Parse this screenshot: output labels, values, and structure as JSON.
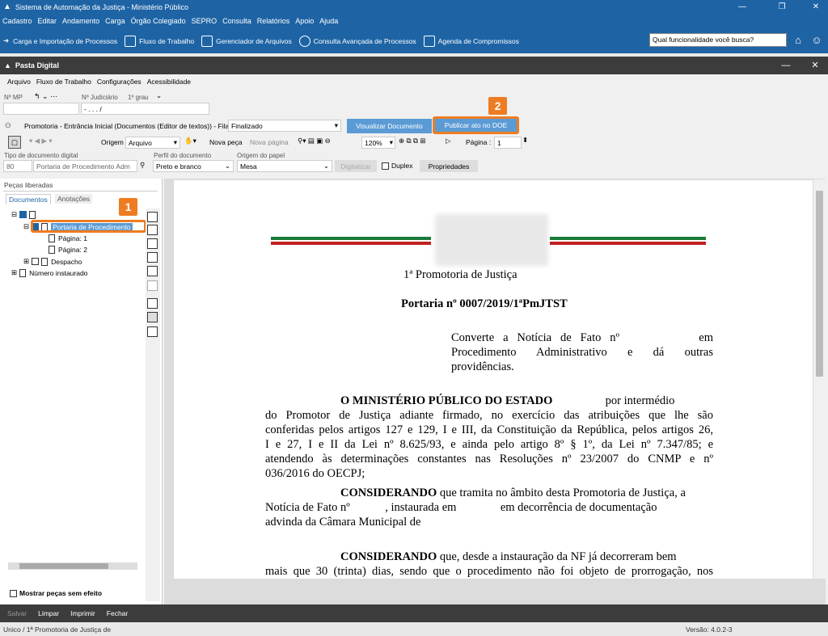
{
  "window": {
    "title": "Sistema de Automação da Justiça - Ministério Público",
    "min": "—",
    "restore": "❐",
    "close": "✕"
  },
  "menu": [
    "Cadastro",
    "Editar",
    "Andamento",
    "Carga",
    "Órgão Colegiado",
    "SEPRO",
    "Consulta",
    "Relatórios",
    "Apoio",
    "Ajuda"
  ],
  "quick": {
    "items": [
      "Carga e Importação de Processos",
      "Fluxo de Trabalho",
      "Gerenciador de Arquivos",
      "Consulta Avançada de Processos",
      "Agenda de Compromissos"
    ],
    "search_placeholder": "Qual funcionalidade você busca?"
  },
  "pasta": {
    "title": "Pasta Digital",
    "min": "—",
    "close": "✕"
  },
  "menu2": [
    "Arquivo",
    "Fluxo de Trabalho",
    "Configurações",
    "Acessibilidade"
  ],
  "fields": {
    "nmp_label": "Nº MP",
    "nj_label": "Nº Judiciário",
    "grau": "1º grau",
    "nj_value": "- . . . /",
    "fila_text": "Promotoria - Entrância Inicial (Documentos (Editor de textos)) - Fila",
    "fila_value": "Finalizado"
  },
  "buttons": {
    "visualizar": "Visualizar Documento",
    "publicar": "Publicar ato no DOE",
    "badge1": "1",
    "badge2": "2"
  },
  "toolbar": {
    "origem_label": "Origem",
    "origem_value": "Arquivo",
    "nova_peca": "Nova peça",
    "nova_pagina": "Nova página",
    "zoom": "120%",
    "pagina_label": "Página :",
    "pagina_value": "1"
  },
  "docrow": {
    "tipo_label": "Tipo de documento digital",
    "tipo_code": "80",
    "tipo_value": "Portaria de Procedimento Adm",
    "perfil_label": "Perfil do documento",
    "perfil_value": "Preto e branco",
    "origem_label": "Origem do papel",
    "origem_value": "Mesa",
    "digitalizar": "Digitalizar",
    "duplex": "Duplex",
    "propriedades": "Propriedades"
  },
  "left": {
    "title": "Peças liberadas",
    "tabs": [
      "Documentos",
      "Anotações"
    ],
    "tree": [
      "Portaria de Procedimento",
      "Página: 1",
      "Página: 2",
      "Despacho",
      "Número instaurado"
    ],
    "mostrar": "Mostrar peças sem efeito"
  },
  "doc": {
    "promotoria": "1ª Promotoria de Justiça",
    "portaria": "Portaria nº 0007/2019/1ªPmJTST",
    "converte": [
      "Converte a Notícia de Fato nº",
      "em",
      "Procedimento Administrativo e dá outras",
      "providências."
    ],
    "p1_bold": "O MINISTÉRIO PÚBLICO DO ESTADO",
    "p1_lines": [
      "por intermédio",
      "do Promotor de Justiça adiante firmado, no exercício das atribuições que lhe são",
      "conferidas pelos artigos 127 e 129, I e III, da Constituição da República, pelos artigos 26,",
      "I e 27, I e II da Lei nº 8.625/93, e ainda pelo artigo 8º § 1º, da Lei nº 7.347/85; e",
      "atendendo às determinações constantes nas Resoluções nº 23/2007 do CNMP e nº",
      "036/2016 do OECPJ;"
    ],
    "p2_bold": "CONSIDERANDO",
    "p2_lines": [
      "que tramita no âmbito desta Promotoria de Justiça, a",
      "Notícia de Fato nº",
      ", instaurada em",
      "em decorrência de documentação",
      "advinda da Câmara Municipal de"
    ],
    "p3_bold": "CONSIDERANDO",
    "p3_lines": [
      "que, desde a instauração da NF já decorreram bem",
      "mais que 30 (trinta) dias, sendo que o procedimento não foi objeto de prorrogação, nos"
    ]
  },
  "bottom": [
    "Salvar",
    "Limpar",
    "Imprimir",
    "Fechar"
  ],
  "status": {
    "left": "Unico / 1ª Promotoria de Justiça de",
    "version": "Versão: 4.0.2-3"
  }
}
